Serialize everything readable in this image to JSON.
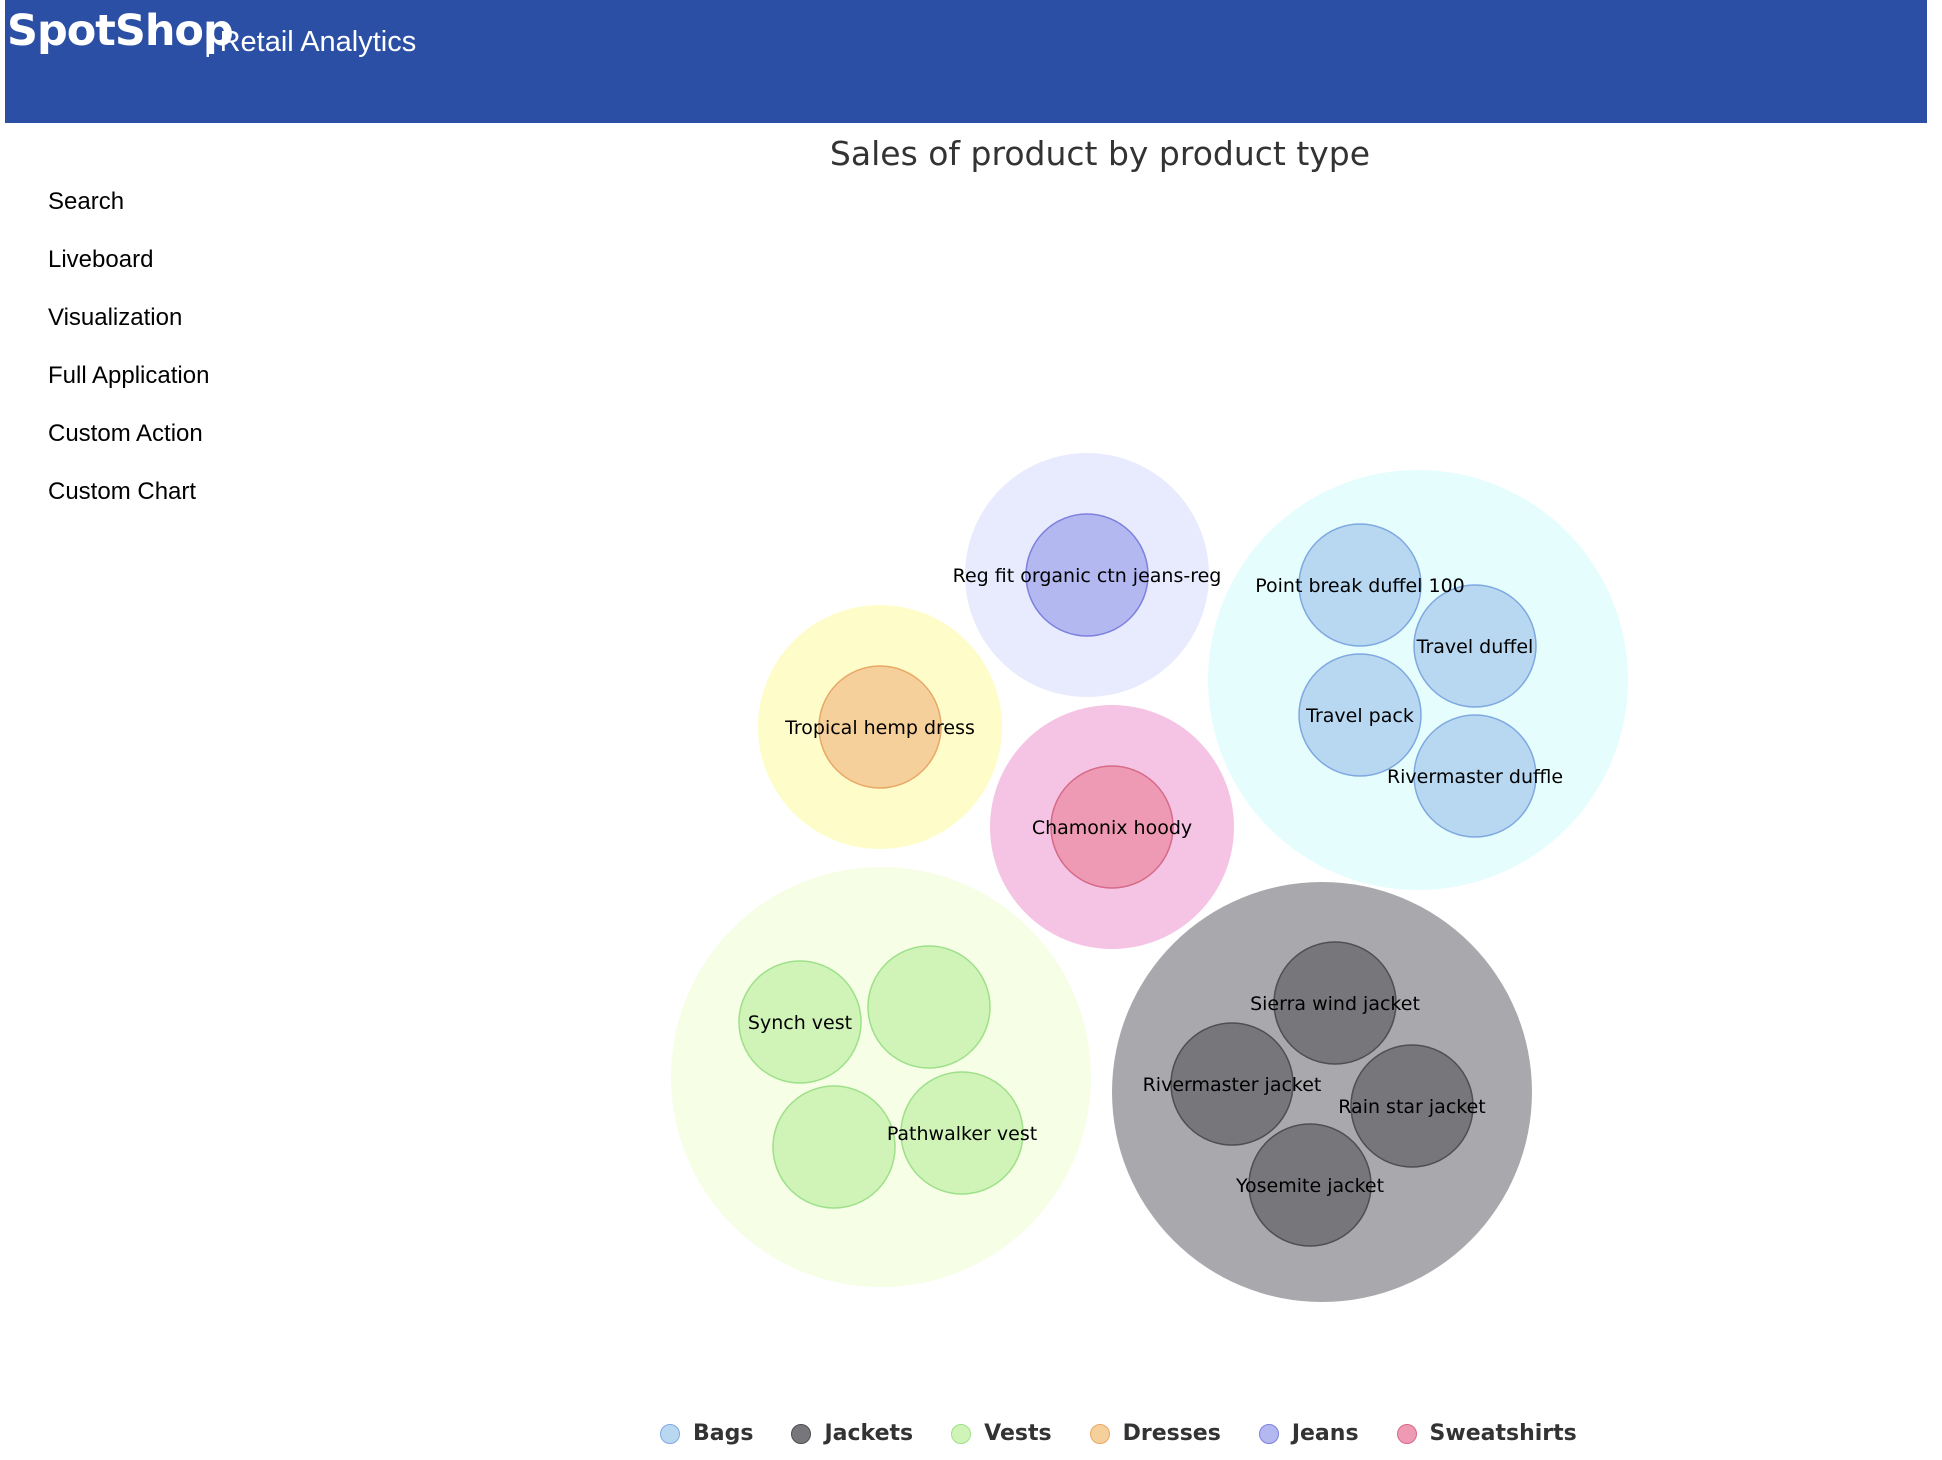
{
  "header": {
    "logo_text": "SpotShop",
    "app_title": "| Retail Analytics"
  },
  "nav": {
    "items": [
      {
        "label": "Search"
      },
      {
        "label": "Liveboard"
      },
      {
        "label": "Visualization"
      },
      {
        "label": "Full Application"
      },
      {
        "label": "Custom Action"
      },
      {
        "label": "Custom Chart"
      }
    ]
  },
  "chart_data": {
    "type": "packed-bubble",
    "title": "Sales of product by product type",
    "legend_position": "bottom",
    "series": [
      {
        "name": "Bags",
        "color": "#b8d8f2",
        "stroke": "#7ea8e0",
        "parent_color": "#e6fdfd",
        "items": [
          "Point break duffel 100",
          "Travel duffel",
          "Travel pack",
          "Rivermaster duffle"
        ]
      },
      {
        "name": "Jackets",
        "color": "#77767b",
        "stroke": "#4f4e53",
        "parent_color": "#a9a8ad",
        "items": [
          "Sierra wind jacket",
          "Rivermaster jacket",
          "Rain star jacket",
          "Yosemite jacket"
        ]
      },
      {
        "name": "Vests",
        "color": "#d0f4b8",
        "stroke": "#9ee08a",
        "parent_color": "#f6fee6",
        "items": [
          "Synch vest",
          "",
          "",
          "Pathwalker vest"
        ]
      },
      {
        "name": "Dresses",
        "color": "#f5d09a",
        "stroke": "#e8a868",
        "parent_color": "#fefdca",
        "items": [
          "Tropical hemp dress"
        ]
      },
      {
        "name": "Jeans",
        "color": "#b4b8f0",
        "stroke": "#7d80dd",
        "parent_color": "#e8ebfd",
        "items": [
          "Reg fit organic ctn jeans-reg"
        ]
      },
      {
        "name": "Sweatshirts",
        "color": "#ee9ab4",
        "stroke": "#d66a88",
        "parent_color": "#f5c4e4",
        "items": [
          "Chamonix hoody"
        ]
      }
    ]
  }
}
